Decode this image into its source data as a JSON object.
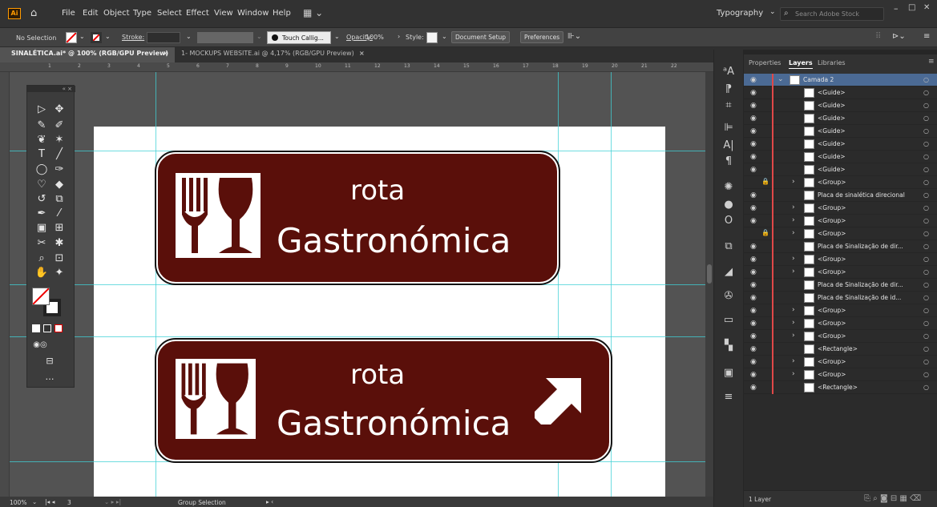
{
  "menubar": {
    "app_icon": "Ai",
    "items": [
      "File",
      "Edit",
      "Object",
      "Type",
      "Select",
      "Effect",
      "View",
      "Window",
      "Help"
    ],
    "workspace": "Typography",
    "search_placeholder": "Search Adobe Stock",
    "window_controls": [
      "–",
      "□",
      "✕"
    ]
  },
  "control": {
    "selection": "No Selection",
    "stroke_label": "Stroke:",
    "brush": "Touch Callig...",
    "opacity_label": "Opacity:",
    "opacity_value": "100%",
    "style_label": "Style:",
    "document_setup": "Document Setup",
    "preferences": "Preferences"
  },
  "tabs": [
    {
      "label": "SINALÉTICA.ai* @ 100% (RGB/GPU Preview)",
      "close": "×"
    },
    {
      "label": "1- MOCKUPS WEBSITE.ai @ 4,17% (RGB/GPU Preview)",
      "close": "×"
    }
  ],
  "ruler": {
    "marks": [
      "1",
      "2",
      "3",
      "4",
      "5",
      "6",
      "7",
      "8",
      "9",
      "10",
      "11",
      "12",
      "13",
      "14",
      "15",
      "16",
      "17",
      "18",
      "19",
      "20",
      "21",
      "22"
    ]
  },
  "signs": [
    {
      "line1": "rota",
      "line2": "Gastronómica",
      "arrow": false
    },
    {
      "line1": "rota",
      "line2": "Gastronómica",
      "arrow": true,
      "arrow_icon": "arrow-up-right-icon"
    }
  ],
  "status": {
    "zoom": "100%",
    "artboard": "3",
    "tool": "Group Selection"
  },
  "panel": {
    "tabs": [
      "Properties",
      "Layers",
      "Libraries"
    ],
    "active_tab": "Layers",
    "layer_count": "1 Layer",
    "rows": [
      {
        "name": "Camada 2",
        "vis": true,
        "lock": false,
        "chev": "⌄",
        "top": true
      },
      {
        "name": "<Guide>",
        "vis": true,
        "lock": false,
        "chev": ""
      },
      {
        "name": "<Guide>",
        "vis": true,
        "lock": false,
        "chev": ""
      },
      {
        "name": "<Guide>",
        "vis": true,
        "lock": false,
        "chev": ""
      },
      {
        "name": "<Guide>",
        "vis": true,
        "lock": false,
        "chev": ""
      },
      {
        "name": "<Guide>",
        "vis": true,
        "lock": false,
        "chev": ""
      },
      {
        "name": "<Guide>",
        "vis": true,
        "lock": false,
        "chev": ""
      },
      {
        "name": "<Guide>",
        "vis": true,
        "lock": false,
        "chev": ""
      },
      {
        "name": "<Group>",
        "vis": false,
        "lock": true,
        "chev": "›"
      },
      {
        "name": "Placa de sinalética direcional",
        "vis": true,
        "lock": false,
        "chev": ""
      },
      {
        "name": "<Group>",
        "vis": true,
        "lock": false,
        "chev": "›"
      },
      {
        "name": "<Group>",
        "vis": true,
        "lock": false,
        "chev": "›"
      },
      {
        "name": "<Group>",
        "vis": false,
        "lock": true,
        "chev": "›"
      },
      {
        "name": "Placa de Sinalização de dir...",
        "vis": true,
        "lock": false,
        "chev": ""
      },
      {
        "name": "<Group>",
        "vis": true,
        "lock": false,
        "chev": "›"
      },
      {
        "name": "<Group>",
        "vis": true,
        "lock": false,
        "chev": "›"
      },
      {
        "name": "Placa de Sinalização de dir...",
        "vis": true,
        "lock": false,
        "chev": ""
      },
      {
        "name": "Placa de Sinalização de id...",
        "vis": true,
        "lock": false,
        "chev": ""
      },
      {
        "name": "<Group>",
        "vis": true,
        "lock": false,
        "chev": "›"
      },
      {
        "name": "<Group>",
        "vis": true,
        "lock": false,
        "chev": "›"
      },
      {
        "name": "<Group>",
        "vis": true,
        "lock": false,
        "chev": "›"
      },
      {
        "name": "<Rectangle>",
        "vis": true,
        "lock": false,
        "chev": ""
      },
      {
        "name": "<Group>",
        "vis": true,
        "lock": false,
        "chev": "›"
      },
      {
        "name": "<Group>",
        "vis": true,
        "lock": false,
        "chev": "›"
      },
      {
        "name": "<Rectangle>",
        "vis": true,
        "lock": false,
        "chev": ""
      }
    ]
  },
  "colors": {
    "sign_fill": "#5a0f0a",
    "guide": "#3fd0d6",
    "layer_color": "#e04848",
    "selected_row": "#4b6a94"
  }
}
